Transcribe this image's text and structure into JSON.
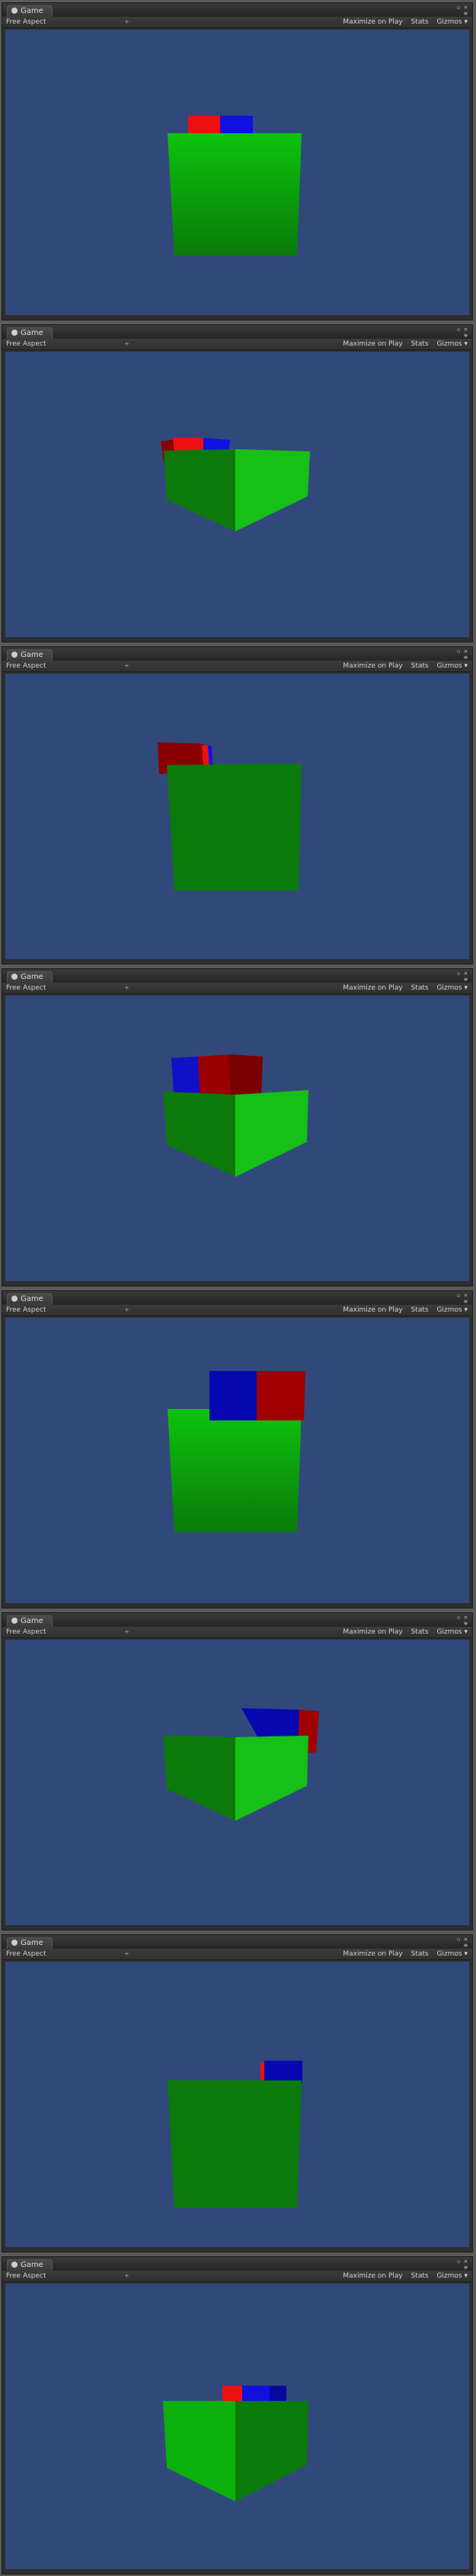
{
  "panels": [
    {
      "tab": "Game",
      "aspect": "Free Aspect",
      "aspect_arrow": "÷",
      "maximize": "Maximize on Play",
      "stats": "Stats",
      "gizmos": "Gizmos ▾"
    },
    {
      "tab": "Game",
      "aspect": "Free Aspect",
      "aspect_arrow": "÷",
      "maximize": "Maximize on Play",
      "stats": "Stats",
      "gizmos": "Gizmos ▾"
    },
    {
      "tab": "Game",
      "aspect": "Free Aspect",
      "aspect_arrow": "÷",
      "maximize": "Maximize on Play",
      "stats": "Stats",
      "gizmos": "Gizmos ▾"
    },
    {
      "tab": "Game",
      "aspect": "Free Aspect",
      "aspect_arrow": "÷",
      "maximize": "Maximize on Play",
      "stats": "Stats",
      "gizmos": "Gizmos ▾"
    },
    {
      "tab": "Game",
      "aspect": "Free Aspect",
      "aspect_arrow": "÷",
      "maximize": "Maximize on Play",
      "stats": "Stats",
      "gizmos": "Gizmos ▾"
    },
    {
      "tab": "Game",
      "aspect": "Free Aspect",
      "aspect_arrow": "÷",
      "maximize": "Maximize on Play",
      "stats": "Stats",
      "gizmos": "Gizmos ▾"
    },
    {
      "tab": "Game",
      "aspect": "Free Aspect",
      "aspect_arrow": "÷",
      "maximize": "Maximize on Play",
      "stats": "Stats",
      "gizmos": "Gizmos ▾"
    },
    {
      "tab": "Game",
      "aspect": "Free Aspect",
      "aspect_arrow": "÷",
      "maximize": "Maximize on Play",
      "stats": "Stats",
      "gizmos": "Gizmos ▾"
    }
  ],
  "colors": {
    "viewport_bg": "#31497a",
    "cube_green": "#0a8f0a",
    "block_red": "#cc0000",
    "block_blue": "#0000cc"
  }
}
